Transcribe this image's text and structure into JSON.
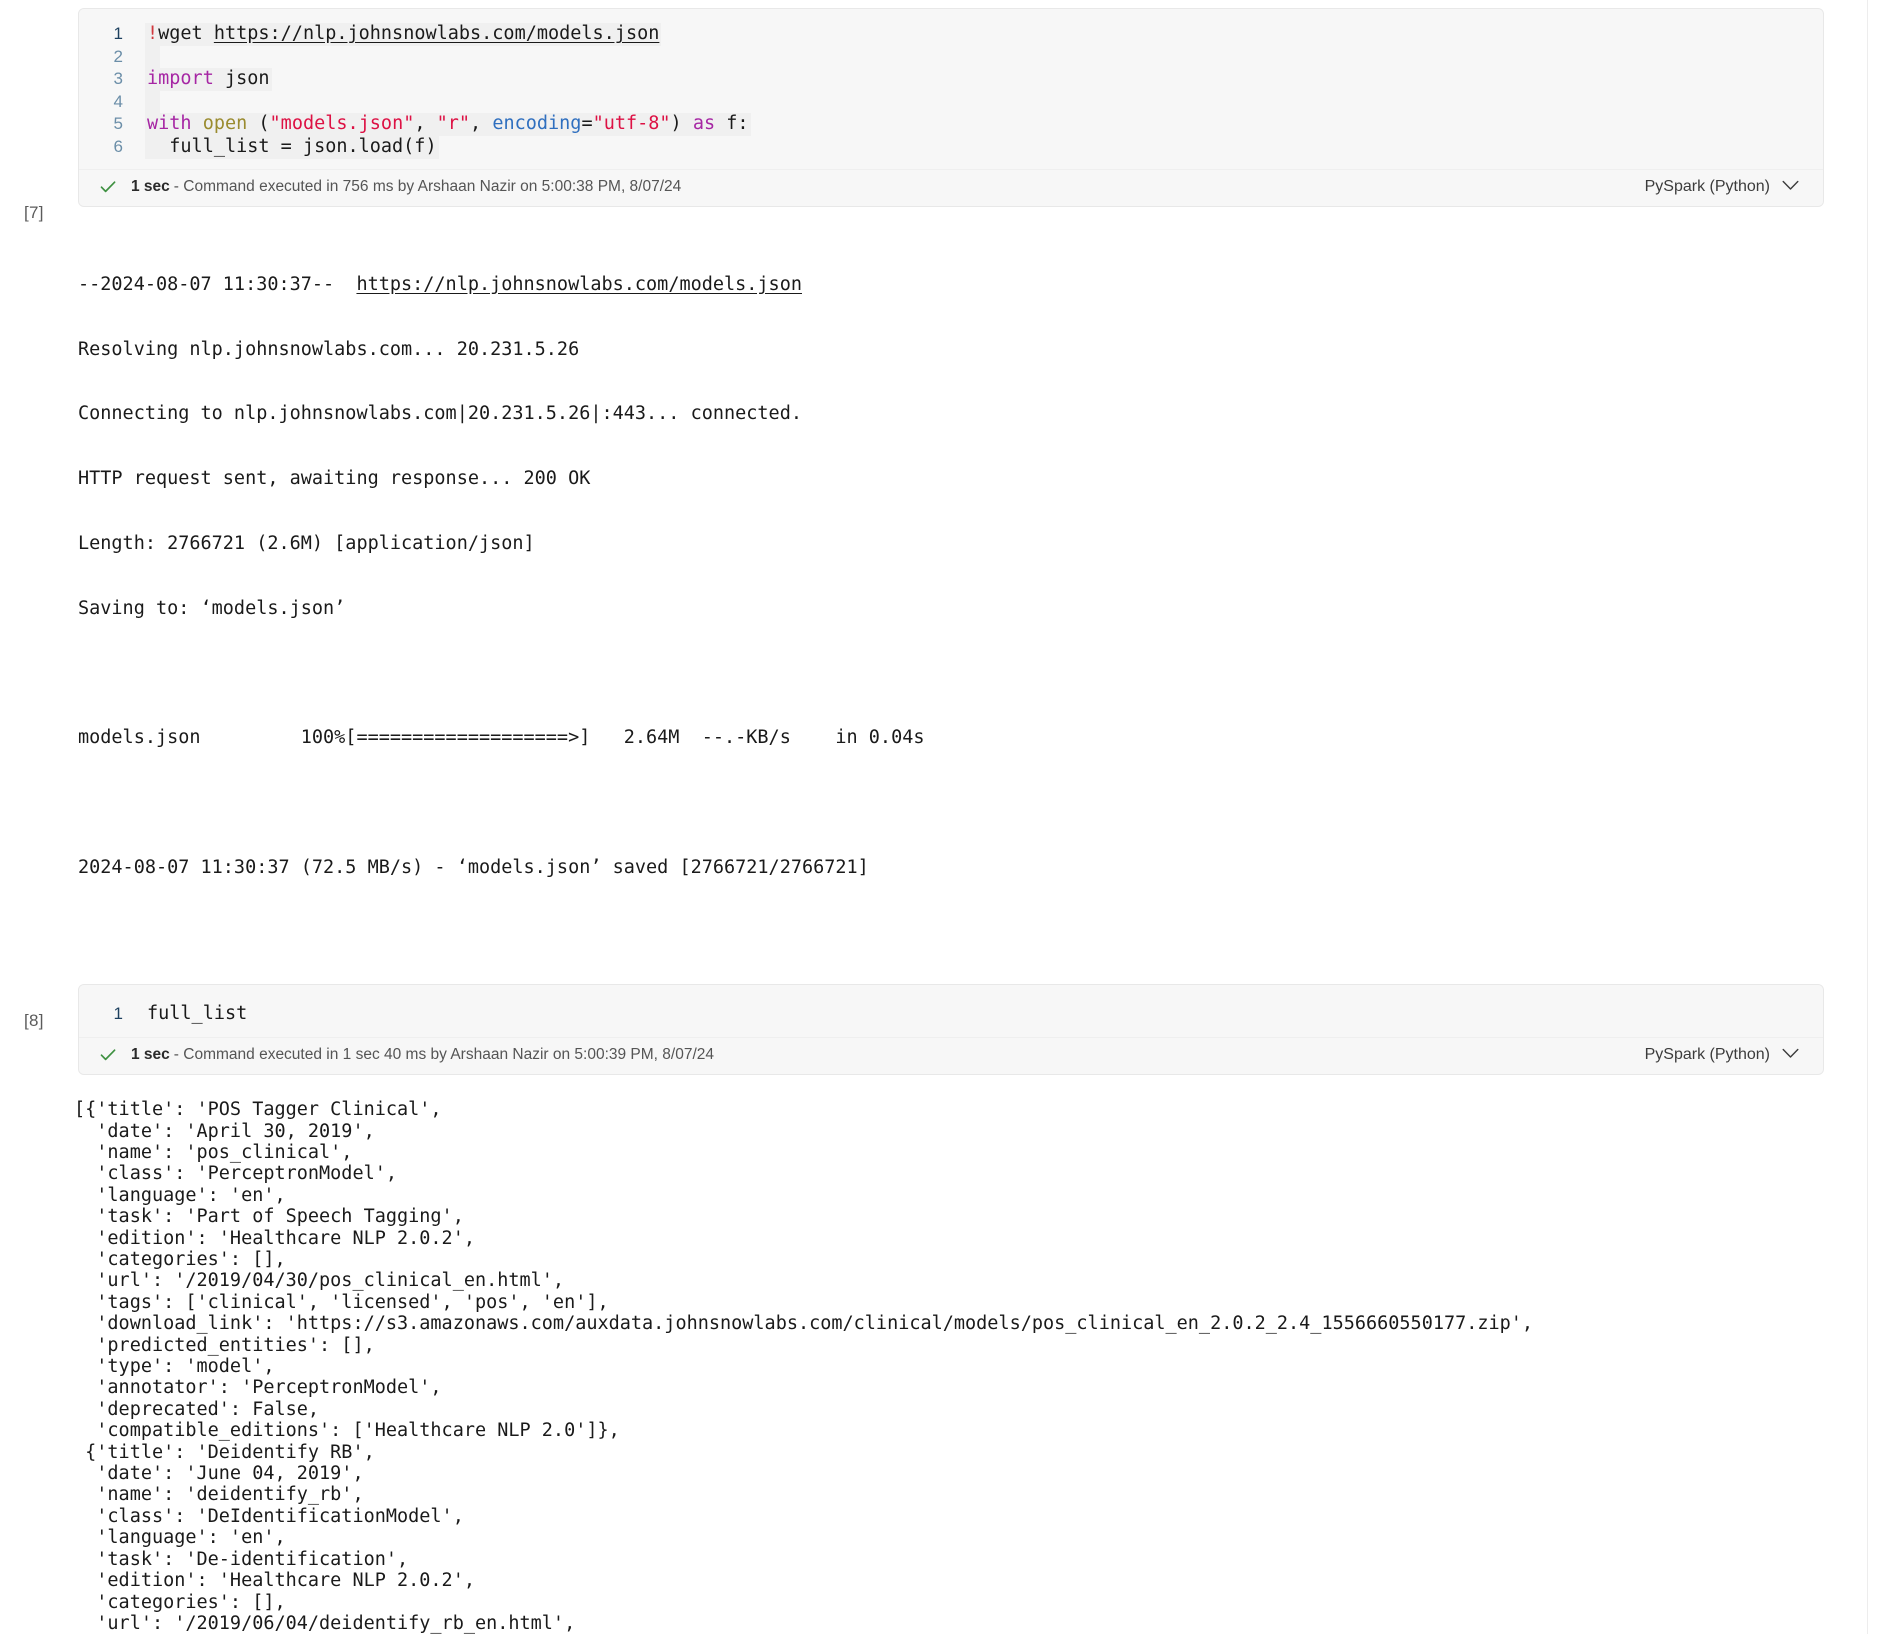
{
  "cells": [
    {
      "exec_count": "[7]",
      "lines": [
        {
          "n": "1",
          "segments": [
            {
              "t": "!",
              "c": "t-bang"
            },
            {
              "t": "wget ",
              "c": "t-plain"
            },
            {
              "t": "https://nlp.johnsnowlabs.com/models.json",
              "c": "t-link"
            }
          ]
        },
        {
          "n": "2",
          "segments": [
            {
              "t": " ",
              "c": "t-plain"
            }
          ]
        },
        {
          "n": "3",
          "segments": [
            {
              "t": "import",
              "c": "t-kw"
            },
            {
              "t": " json",
              "c": "t-plain"
            }
          ]
        },
        {
          "n": "4",
          "segments": [
            {
              "t": " ",
              "c": "t-plain"
            }
          ]
        },
        {
          "n": "5",
          "segments": [
            {
              "t": "with ",
              "c": "t-kw"
            },
            {
              "t": "open ",
              "c": "t-bi"
            },
            {
              "t": "(",
              "c": "t-plain"
            },
            {
              "t": "\"models.json\"",
              "c": "t-str"
            },
            {
              "t": ", ",
              "c": "t-plain"
            },
            {
              "t": "\"r\"",
              "c": "t-str"
            },
            {
              "t": ", ",
              "c": "t-plain"
            },
            {
              "t": "encoding",
              "c": "t-param"
            },
            {
              "t": "=",
              "c": "t-plain"
            },
            {
              "t": "\"utf-8\"",
              "c": "t-str"
            },
            {
              "t": ") ",
              "c": "t-plain"
            },
            {
              "t": "as",
              "c": "t-kw"
            },
            {
              "t": " f:",
              "c": "t-plain"
            }
          ]
        },
        {
          "n": "6",
          "segments": [
            {
              "t": "  full_list = json.load(f)",
              "c": "t-plain"
            }
          ]
        }
      ],
      "status": {
        "icon": "check-icon",
        "duration": "1 sec",
        "message": "- Command executed in 756 ms by Arshaan Nazir on 5:00:38 PM, 8/07/24",
        "language": "PySpark (Python)"
      },
      "output_lines": [
        "--2024-08-07 11:30:37--  ",
        "Resolving nlp.johnsnowlabs.com... 20.231.5.26",
        "Connecting to nlp.johnsnowlabs.com|20.231.5.26|:443... connected.",
        "HTTP request sent, awaiting response... 200 OK",
        "Length: 2766721 (2.6M) [application/json]",
        "Saving to: ‘models.json’",
        "",
        "models.json         100%[===================>]   2.64M  --.-KB/s    in 0.04s",
        "",
        "2024-08-07 11:30:37 (72.5 MB/s) - ‘models.json’ saved [2766721/2766721]"
      ],
      "output_link": "https://nlp.johnsnowlabs.com/models.json"
    },
    {
      "exec_count": "[8]",
      "lines": [
        {
          "n": "1",
          "segments": [
            {
              "t": "full_list",
              "c": "t-plain"
            }
          ]
        }
      ],
      "status": {
        "icon": "check-icon",
        "duration": "1 sec",
        "message": "- Command executed in 1 sec 40 ms by Arshaan Nazir on 5:00:39 PM, 8/07/24",
        "language": "PySpark (Python)"
      },
      "json_output": "[{'title': 'POS Tagger Clinical',\n  'date': 'April 30, 2019',\n  'name': 'pos_clinical',\n  'class': 'PerceptronModel',\n  'language': 'en',\n  'task': 'Part of Speech Tagging',\n  'edition': 'Healthcare NLP 2.0.2',\n  'categories': [],\n  'url': '/2019/04/30/pos_clinical_en.html',\n  'tags': ['clinical', 'licensed', 'pos', 'en'],\n  'download_link': 'https://s3.amazonaws.com/auxdata.johnsnowlabs.com/clinical/models/pos_clinical_en_2.0.2_2.4_1556660550177.zip',\n  'predicted_entities': [],\n  'type': 'model',\n  'annotator': 'PerceptronModel',\n  'deprecated': False,\n  'compatible_editions': ['Healthcare NLP 2.0']},\n {'title': 'Deidentify RB',\n  'date': 'June 04, 2019',\n  'name': 'deidentify_rb',\n  'class': 'DeIdentificationModel',\n  'language': 'en',\n  'task': 'De-identification',\n  'edition': 'Healthcare NLP 2.0.2',\n  'categories': [],\n  'url': '/2019/06/04/deidentify_rb_en.html',"
    }
  ],
  "colors": {
    "cell_bg": "#f7f7f7",
    "code_highlight": "#f0f0f0",
    "success": "#3f9142",
    "line_number": "#6b8ea8",
    "keyword": "#a626a4",
    "string": "#dd1144",
    "builtin": "#9a8b2f",
    "param": "#2f6fbf",
    "bang": "#d1383d"
  }
}
